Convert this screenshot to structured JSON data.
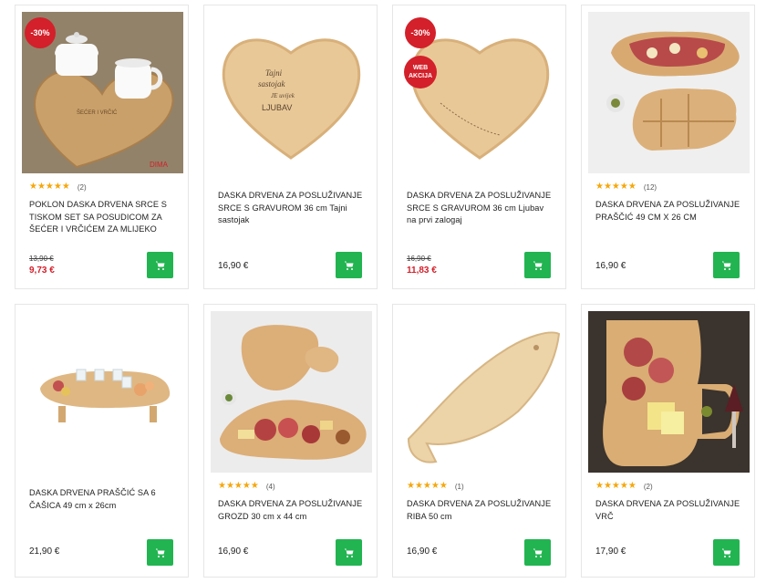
{
  "cards": [
    {
      "badge_discount": "-30%",
      "badge_web": "",
      "stars": "★★★★★",
      "reviews": "(2)",
      "title_lines": [
        "POKLON DASKA DRVENA SRCE S",
        "TISKOM SET SA POSUDICOM ZA",
        "ŠEĆER I VRČIĆEM ZA MLIJEKO"
      ],
      "old_price": "13,90 €",
      "price": "9,73 €",
      "image": "heart-board-with-sugar-bowl-and-milk-jug",
      "image_text": [
        "ŠEĆER I VRČIĆ",
        "DIMA"
      ]
    },
    {
      "badge_discount": "",
      "badge_web": "",
      "stars": "",
      "reviews": "",
      "title_lines": [
        "DASKA DRVENA ZA POSLUŽIVANJE",
        "SRCE S GRAVUROM 36 cm Tajni",
        "sastojak"
      ],
      "old_price": "",
      "price": "16,90 €",
      "image": "engraved-heart-board",
      "image_text": [
        "Tajni",
        "sastojak",
        "JE uvijek",
        "LJUBAV"
      ]
    },
    {
      "badge_discount": "-30%",
      "badge_web": "WEB AKCIJA",
      "stars": "",
      "reviews": "",
      "title_lines": [
        "DASKA DRVENA ZA POSLUŽIVANJE",
        "SRCE S GRAVUROM 36 cm Ljubav",
        "na prvi zalogaj"
      ],
      "old_price": "16,90 €",
      "price": "11,83 €",
      "image": "engraved-heart-board-2",
      "image_text": []
    },
    {
      "badge_discount": "",
      "badge_web": "",
      "stars": "★★★★★",
      "reviews": "(12)",
      "title_lines": [
        "DASKA DRVENA ZA POSLUŽIVANJE",
        "PRAŠČIĆ 49 cm x 26 cm"
      ],
      "old_price": "",
      "price": "16,90 €",
      "image": "pig-shaped-boards",
      "image_text": []
    },
    {
      "badge_discount": "",
      "badge_web": "",
      "stars": "",
      "reviews": "",
      "title_lines": [
        "DASKA DRVENA PRAŠČIĆ SA 6",
        "ČAŠICA 49 cm x 26cm"
      ],
      "old_price": "",
      "price": "21,90 €",
      "image": "pig-board-with-glasses",
      "image_text": []
    },
    {
      "badge_discount": "",
      "badge_web": "",
      "stars": "★★★★★",
      "reviews": "(4)",
      "title_lines": [
        "DASKA DRVENA ZA POSLUŽIVANJE",
        "GROZD 30 cm x 44 cm"
      ],
      "old_price": "",
      "price": "16,90 €",
      "image": "grape-shaped-board",
      "image_text": []
    },
    {
      "badge_discount": "",
      "badge_web": "",
      "stars": "★★★★★",
      "reviews": "(1)",
      "title_lines": [
        "DASKA DRVENA ZA POSLUŽIVANJE",
        "RIBA 50 cm"
      ],
      "old_price": "",
      "price": "16,90 €",
      "image": "fish-shaped-board",
      "image_text": []
    },
    {
      "badge_discount": "",
      "badge_web": "",
      "stars": "★★★★★",
      "reviews": "(2)",
      "title_lines": [
        "DASKA DRVENA ZA POSLUŽIVANJE",
        "VRČ"
      ],
      "old_price": "",
      "price": "17,90 €",
      "image": "jug-shaped-board",
      "image_text": []
    }
  ],
  "icons": {
    "cart": "shopping-cart-icon",
    "star": "star-icon"
  },
  "colors": {
    "accent_green": "#22b451",
    "sale_red": "#d3202a",
    "star_gold": "#f5a70a"
  }
}
